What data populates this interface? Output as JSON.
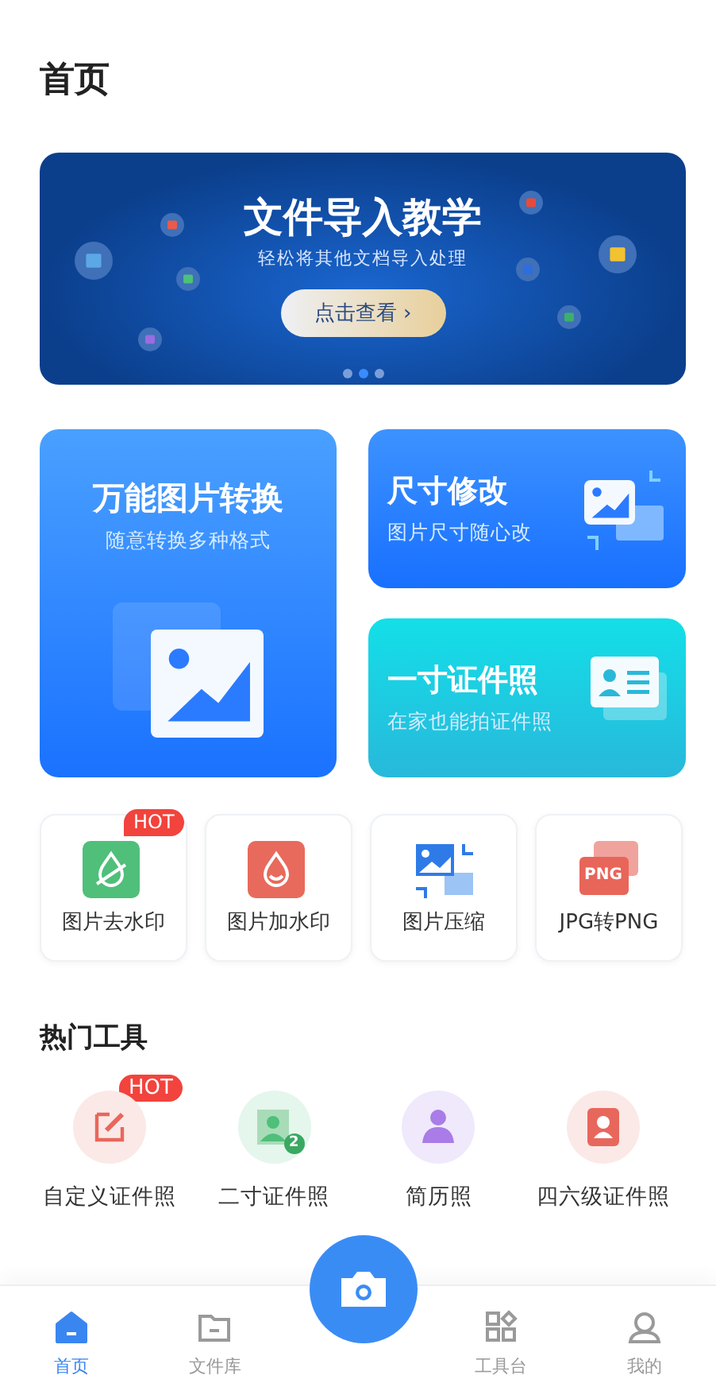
{
  "page_title": "首页",
  "banner": {
    "title": "文件导入教学",
    "subtitle": "轻松将其他文档导入处理",
    "button": "点击查看 ›",
    "dots": [
      {
        "selected": false
      },
      {
        "selected": true
      },
      {
        "selected": false
      }
    ]
  },
  "feature_cards": [
    {
      "kind": "large",
      "title": "万能图片转换",
      "subtitle": "随意转换多种格式"
    },
    {
      "kind": "resize",
      "title": "尺寸修改",
      "subtitle": "图片尺寸随心改"
    },
    {
      "kind": "idphoto",
      "title": "一寸证件照",
      "subtitle": "在家也能拍证件照"
    }
  ],
  "tools": [
    {
      "kind": "remove-watermark",
      "label": "图片去水印",
      "badge": "HOT"
    },
    {
      "kind": "add-watermark",
      "label": "图片加水印"
    },
    {
      "kind": "compress",
      "label": "图片压缩"
    },
    {
      "kind": "png",
      "label": "JPG转PNG",
      "icon_text": "PNG"
    }
  ],
  "hot_tools": {
    "title": "热门工具",
    "items": [
      {
        "kind": "custom",
        "label": "自定义证件照",
        "badge": "HOT"
      },
      {
        "kind": "two-inch",
        "label": "二寸证件照",
        "icon_text": "2"
      },
      {
        "kind": "resume",
        "label": "简历照"
      },
      {
        "kind": "cet",
        "label": "四六级证件照"
      }
    ]
  },
  "tab_bar": [
    {
      "kind": "home",
      "label": "首页",
      "selected": true
    },
    {
      "kind": "files",
      "label": "文件库",
      "selected": false
    },
    {
      "kind": "camera"
    },
    {
      "kind": "tools",
      "label": "工具台",
      "selected": false
    },
    {
      "kind": "me",
      "label": "我的",
      "selected": false
    }
  ]
}
